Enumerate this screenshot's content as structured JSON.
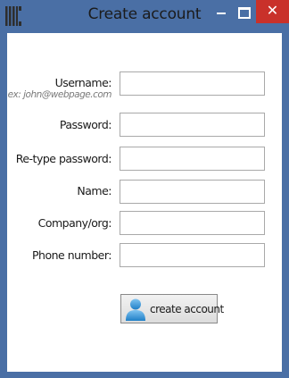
{
  "window": {
    "title": "Create account",
    "close_glyph": "✕",
    "titlebar_color": "#4a6fa5",
    "close_color": "#c9312a"
  },
  "form": {
    "username_label": "Username:",
    "username_hint": "ex: john@webpage.com",
    "username_value": "",
    "password_label": "Password:",
    "password_value": "",
    "retype_label": "Re-type password:",
    "retype_value": "",
    "name_label": "Name:",
    "name_value": "",
    "company_label": "Company/org:",
    "company_value": "",
    "phone_label": "Phone number:",
    "phone_value": ""
  },
  "actions": {
    "create_label": "create account",
    "create_icon": "user-icon"
  }
}
